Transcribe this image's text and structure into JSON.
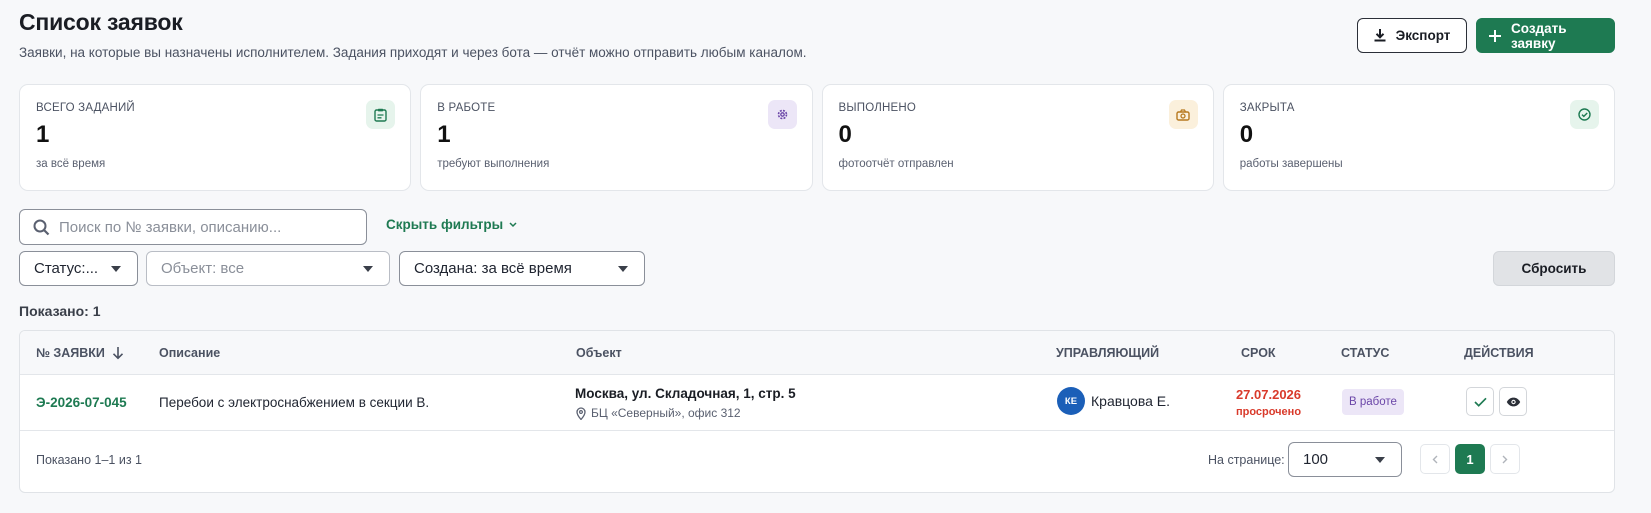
{
  "header": {
    "title": "Список заявок",
    "subtitle": "Заявки, на которые вы назначены исполнителем. Задания приходят и через бота — отчёт можно отправить любым каналом.",
    "export_label": "Экспорт",
    "create_label": "Создать заявку"
  },
  "stats": [
    {
      "label": "ВСЕГО ЗАДАНИЙ",
      "value": "1",
      "note": "за всё время",
      "icon": "clipboard-icon",
      "color": "#1e7a52",
      "bg": "#e6f4ec"
    },
    {
      "label": "В РАБОТЕ",
      "value": "1",
      "note": "требуют выполнения",
      "icon": "gear-icon",
      "color": "#6b46a8",
      "bg": "#ece6f7"
    },
    {
      "label": "ВЫПОЛНЕНО",
      "value": "0",
      "note": "фотоотчёт отправлен",
      "icon": "camera-icon",
      "color": "#b7791f",
      "bg": "#fbf0dc"
    },
    {
      "label": "ЗАКРЫТА",
      "value": "0",
      "note": "работы завершены",
      "icon": "check-circle-icon",
      "color": "#1e7a52",
      "bg": "#e6f4ec"
    }
  ],
  "filters": {
    "search_placeholder": "Поиск по № заявки, описанию...",
    "toggle_label": "Скрыть фильтры",
    "status_value": "Статус:...",
    "object_value": "Объект: все",
    "created_value": "Создана: за всё время",
    "reset_label": "Сбросить"
  },
  "shown_label": "Показано: 1",
  "table": {
    "columns": {
      "id": "№ ЗАЯВКИ",
      "description": "Описание",
      "object": "Объект",
      "manager": "УПРАВЛЯЮЩИЙ",
      "due": "СРОК",
      "status": "СТАТУС",
      "actions": "ДЕЙСТВИЯ"
    },
    "rows": [
      {
        "id": "Э-2026-07-045",
        "description": "Перебои с электроснабжением в секции В.",
        "object_name": "Москва, ул. Складочная, 1, стр. 5",
        "object_detail": "БЦ «Северный», офис 312",
        "manager_initials": "КЕ",
        "manager_name": "Кравцова Е.",
        "due_date": "27.07.2026",
        "due_note": "просрочено",
        "status": "В работе"
      }
    ],
    "footer": {
      "info": "Показано 1–1 из 1",
      "per_page_label": "На странице:",
      "per_page_value": "100",
      "current_page": "1"
    }
  }
}
